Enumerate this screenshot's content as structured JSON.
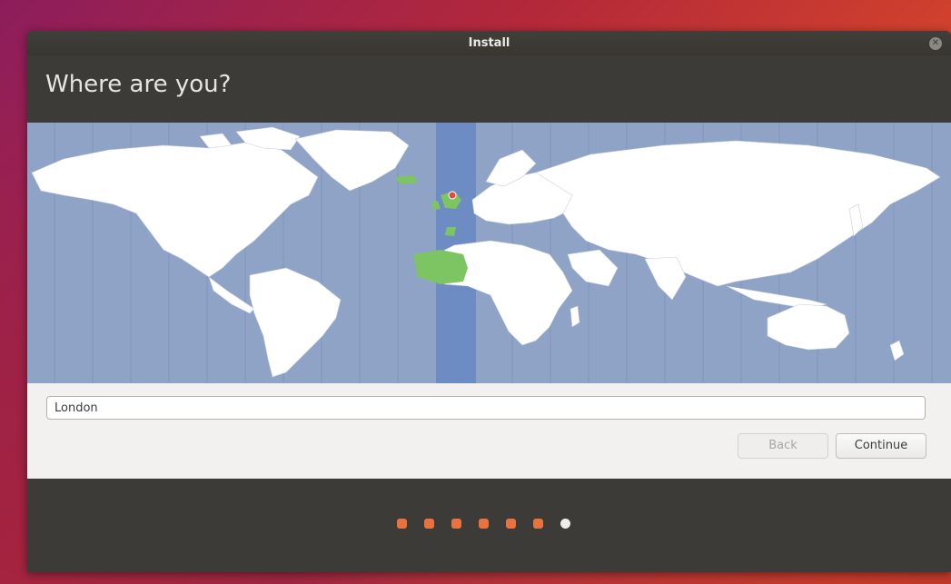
{
  "window": {
    "title": "Install"
  },
  "page": {
    "heading": "Where are you?"
  },
  "location": {
    "value": "London",
    "placeholder": ""
  },
  "buttons": {
    "back": "Back",
    "continue": "Continue"
  },
  "progress": {
    "total_steps": 7,
    "completed_steps": 6,
    "current_step": 7
  },
  "map": {
    "selected_city": "London",
    "selected_timezone_offset": "UTC+0",
    "highlight_color": "#7dc462",
    "pin_color": "#e04a4a"
  },
  "colors": {
    "accent": "#e8733f",
    "titlebar": "#3c3b37",
    "map_ocean": "#8ea3c6",
    "timezone_band": "#6e8cc4"
  }
}
